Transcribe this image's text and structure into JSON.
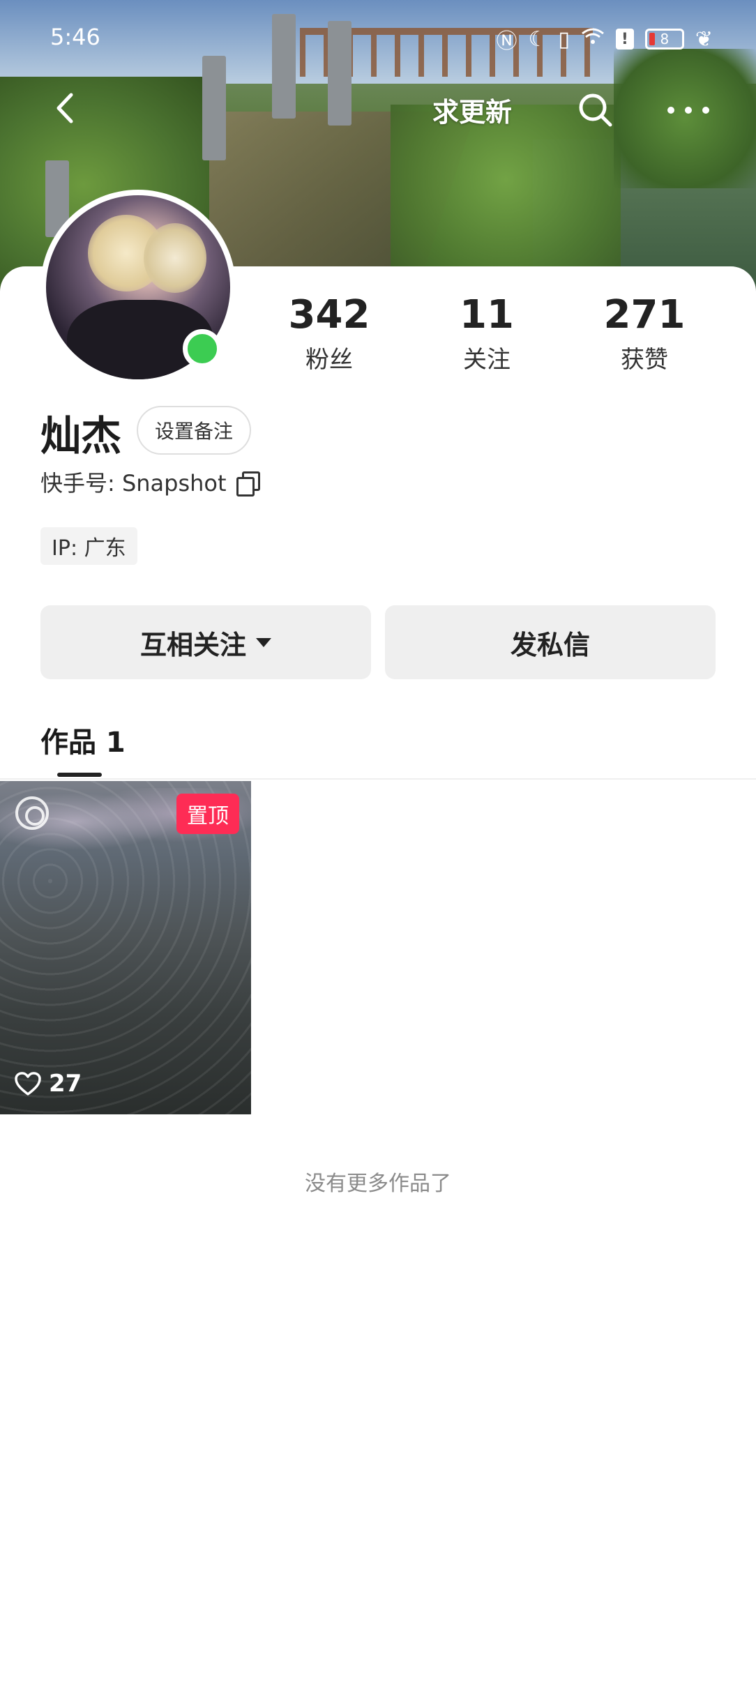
{
  "status_bar": {
    "time": "5:46",
    "battery": "8",
    "icons": [
      "nfc-icon",
      "moon-icon",
      "vibrate-icon",
      "wifi-icon",
      "alert-icon",
      "battery-icon",
      "leaf-icon"
    ]
  },
  "top_nav": {
    "title": "求更新",
    "back_icon": "back-arrow-icon",
    "search_icon": "search-icon",
    "more_icon": "more-dots-icon"
  },
  "profile": {
    "name": "灿杰",
    "remark_button": "设置备注",
    "kuaishou_id": "快手号: Snapshot",
    "ip": "IP: 广东",
    "online": true,
    "stats": [
      {
        "value": "342",
        "label": "粉丝"
      },
      {
        "value": "11",
        "label": "关注"
      },
      {
        "value": "271",
        "label": "获赞"
      }
    ]
  },
  "actions": {
    "follow_button": "互相关注",
    "message_button": "发私信"
  },
  "tabs": [
    {
      "label": "作品 1",
      "active": true
    }
  ],
  "works": [
    {
      "pinned_label": "置顶",
      "likes": "27"
    }
  ],
  "footer": {
    "no_more": "没有更多作品了"
  },
  "colors": {
    "accent": "#fe2c55",
    "online": "#3ccc52",
    "button_bg": "#efefef"
  }
}
